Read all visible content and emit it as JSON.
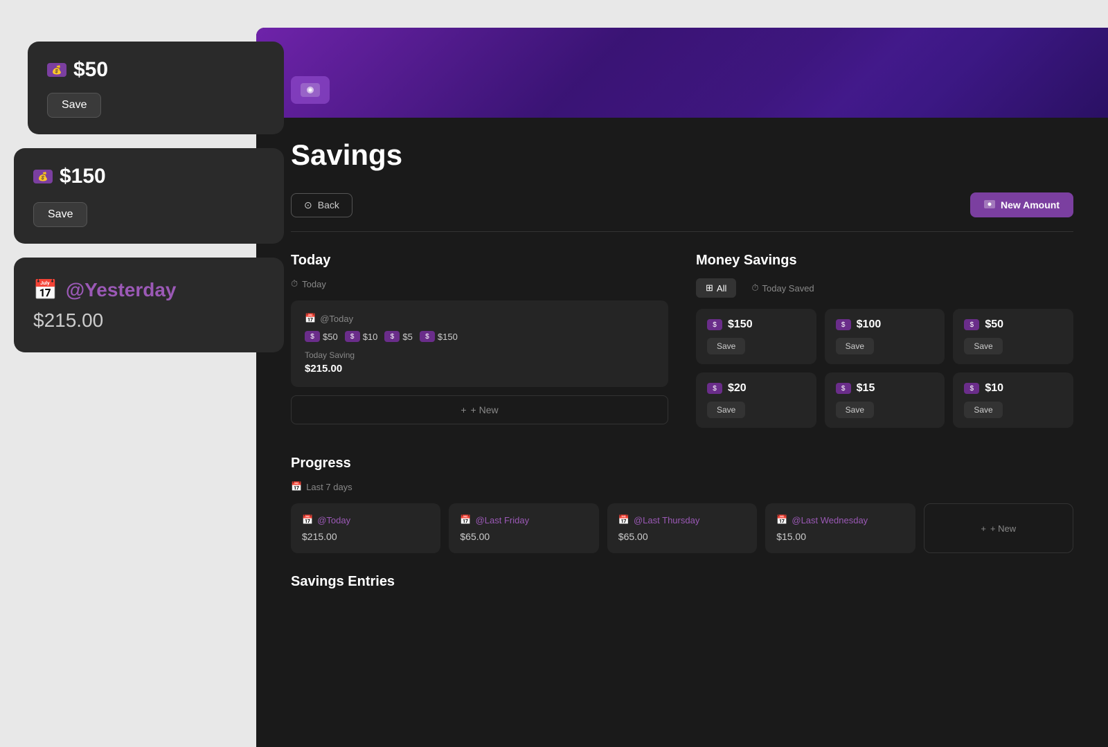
{
  "page": {
    "title": "Savings"
  },
  "toolbar": {
    "back_label": "Back",
    "new_amount_label": "New Amount"
  },
  "float_cards": {
    "card1": {
      "amount": "$50",
      "save_label": "Save"
    },
    "card2": {
      "amount": "$150",
      "save_label": "Save"
    },
    "card3": {
      "date": "@Yesterday",
      "value": "$215.00"
    }
  },
  "today_section": {
    "title": "Today",
    "subtitle": "Today",
    "card": {
      "header": "@Today",
      "amounts": [
        "$50",
        "$10",
        "$5",
        "$150"
      ],
      "saving_label": "Today Saving",
      "saving_value": "$215.00"
    },
    "new_label": "+ New"
  },
  "money_savings": {
    "title": "Money Savings",
    "tabs": [
      {
        "label": "All",
        "active": true
      },
      {
        "label": "Today Saved",
        "active": false
      }
    ],
    "items": [
      {
        "amount": "$150",
        "save_label": "Save"
      },
      {
        "amount": "$100",
        "save_label": "Save"
      },
      {
        "amount": "$50",
        "save_label": "Save"
      },
      {
        "amount": "$20",
        "save_label": "Save"
      },
      {
        "amount": "$15",
        "save_label": "Save"
      },
      {
        "amount": "$10",
        "save_label": "Save"
      }
    ]
  },
  "progress": {
    "title": "Progress",
    "subtitle": "Last 7 days",
    "cards": [
      {
        "date": "@Today",
        "value": "$215.00"
      },
      {
        "date": "@Last Friday",
        "value": "$65.00"
      },
      {
        "date": "@Last Thursday",
        "value": "$65.00"
      },
      {
        "date": "@Last Wednesday",
        "value": "$15.00"
      }
    ],
    "new_label": "+ New"
  },
  "savings_entries": {
    "title": "Savings Entries"
  }
}
